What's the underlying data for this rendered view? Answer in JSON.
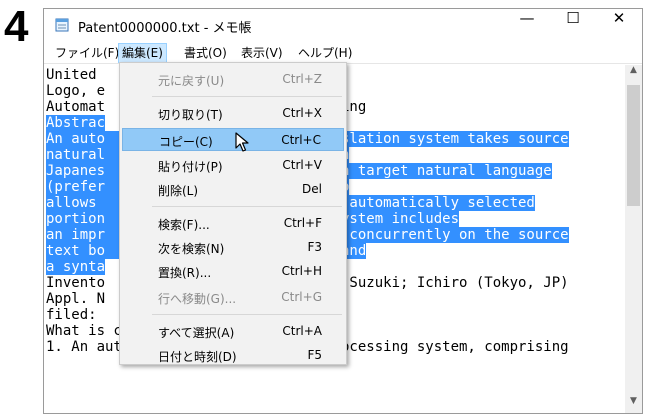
{
  "step_number": "4",
  "window": {
    "title": "Patent0000000.txt - メモ帳"
  },
  "title_controls": {
    "minimize": "—",
    "maximize": "☐",
    "close": "✕"
  },
  "menubar": {
    "file": "ファイル(F)",
    "edit": "編集(E)",
    "format": "書式(O)",
    "view": "表示(V)",
    "help": "ヘルプ(H)"
  },
  "editor": {
    "lines": [
      "United",
      "Logo, e",
      "Automat                         essing",
      "Abstrac",
      "An auto                         ranslation system takes source",
      "natural                         y in",
      "Japanes                         to a target natural language",
      "(prefer                         also",
      "allows                          ate automatically selected",
      "portion                         e system includes",
      "an impr                         ing concurrently on the source",
      "text bo                         is and",
      "a synta",
      "Invento                         P), Suzuki; Ichiro (Tokyo, JP)",
      "Appl. N",
      "filed:",
      "What is claimed is:",
      "1. An automated natural language processing system, comprising"
    ]
  },
  "edit_menu": {
    "items": [
      {
        "label": "元に戻す(U)",
        "shortcut": "Ctrl+Z",
        "enabled": false
      },
      {
        "label": "切り取り(T)",
        "shortcut": "Ctrl+X",
        "enabled": true
      },
      {
        "label": "コピー(C)",
        "shortcut": "Ctrl+C",
        "enabled": true,
        "highlighted": true
      },
      {
        "label": "貼り付け(P)",
        "shortcut": "Ctrl+V",
        "enabled": true
      },
      {
        "label": "削除(L)",
        "shortcut": "Del",
        "enabled": true
      },
      {
        "label": "検索(F)...",
        "shortcut": "Ctrl+F",
        "enabled": true
      },
      {
        "label": "次を検索(N)",
        "shortcut": "F3",
        "enabled": true
      },
      {
        "label": "置換(R)...",
        "shortcut": "Ctrl+H",
        "enabled": true
      },
      {
        "label": "行へ移動(G)...",
        "shortcut": "Ctrl+G",
        "enabled": false
      },
      {
        "label": "すべて選択(A)",
        "shortcut": "Ctrl+A",
        "enabled": true
      },
      {
        "label": "日付と時刻(D)",
        "shortcut": "F5",
        "enabled": true
      }
    ]
  },
  "colors": {
    "selection": "#3390ff",
    "menu_highlight": "#91c9f7",
    "menubar_active": "#cce8ff"
  },
  "icons": {
    "app": "notepad-icon",
    "scroll_up": "chevron-up-icon",
    "scroll_down": "chevron-down-icon",
    "cursor": "mouse-pointer-icon"
  }
}
